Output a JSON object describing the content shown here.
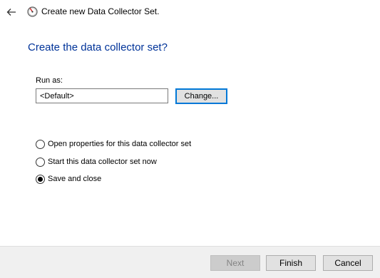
{
  "header": {
    "back_icon": "back-arrow-icon",
    "app_icon": "performance-monitor-icon",
    "title": "Create new Data Collector Set."
  },
  "main": {
    "heading": "Create the data collector set?",
    "run_as": {
      "label": "Run as:",
      "value": "<Default>",
      "change_button": "Change..."
    },
    "options": [
      {
        "label": "Open properties for this data collector set",
        "checked": false
      },
      {
        "label": "Start this data collector set now",
        "checked": false
      },
      {
        "label": "Save and close",
        "checked": true
      }
    ]
  },
  "footer": {
    "next_label": "Next",
    "next_enabled": false,
    "finish_label": "Finish",
    "cancel_label": "Cancel"
  },
  "colors": {
    "heading": "#003399",
    "focus_border": "#0078d7",
    "footer_bg": "#f0f0f0"
  }
}
